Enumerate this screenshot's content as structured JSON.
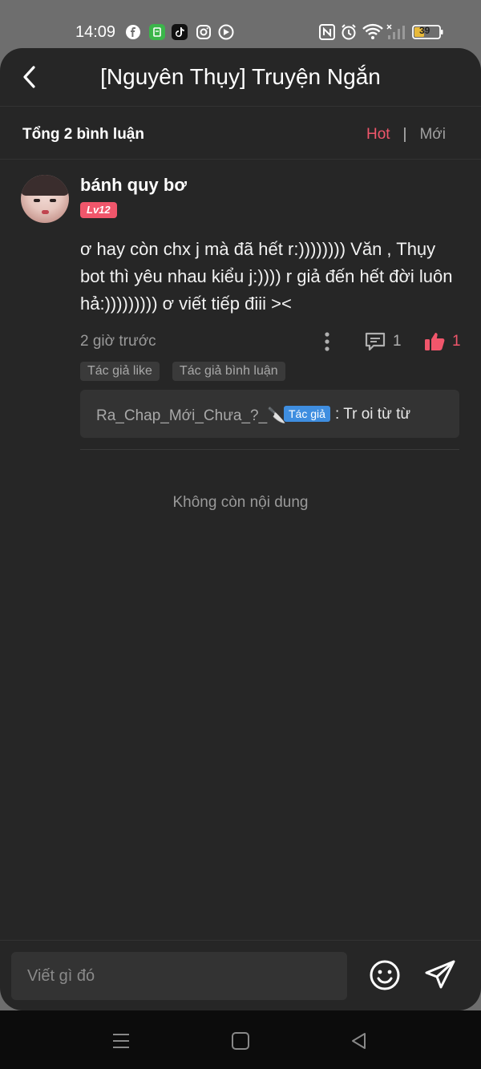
{
  "status_bar": {
    "time": "14:09",
    "battery": "39",
    "apps": [
      "facebook-icon",
      "app-icon",
      "tiktok-icon",
      "instagram-icon",
      "media-icon"
    ],
    "indicators": [
      "nfc-icon",
      "alarm-icon",
      "wifi-icon",
      "signal-icon",
      "battery-icon"
    ]
  },
  "header": {
    "title": "[Nguyên Thụy] Truyện Ngắn",
    "back_icon": "chevron-left-icon"
  },
  "subheader": {
    "total": "Tổng 2 bình luận",
    "sort_hot": "Hot",
    "sort_separator": "|",
    "sort_new": "Mới"
  },
  "comment": {
    "username": "bánh quy bơ",
    "level": "Lv12",
    "text": "ơ hay còn chx j mà đã hết r:)))))))) Văn , Thụy bot thì yêu nhau kiểu j:)))) r giả đến hết đời luôn hả:))))))))) ơ viết tiếp điii ><",
    "time": "2 giờ trước",
    "reply_count": "1",
    "like_count": "1",
    "tags": [
      "Tác giả like",
      "Tác giả bình luận"
    ],
    "reply": {
      "author": "Ra_Chap_Mới_Chưa_?_🔪",
      "badge": "Tác giả",
      "text": ": Tr oi từ từ"
    }
  },
  "footer_note": "Không còn nội dung",
  "input": {
    "placeholder": "Viết gì đó"
  },
  "colors": {
    "accent": "#f0566b",
    "background": "#262626",
    "badge_blue": "#3f8ee0"
  }
}
